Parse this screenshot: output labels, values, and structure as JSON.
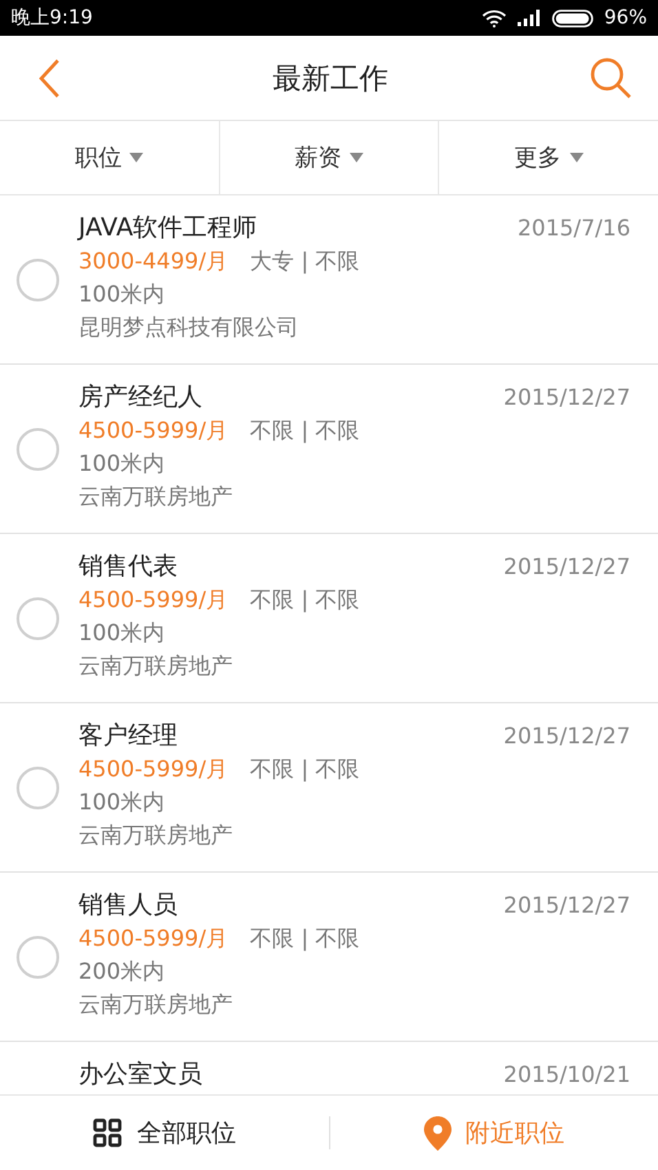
{
  "status_bar": {
    "time": "晚上9:19",
    "battery": "96%"
  },
  "header": {
    "title": "最新工作"
  },
  "filters": [
    {
      "label": "职位"
    },
    {
      "label": "薪资"
    },
    {
      "label": "更多"
    }
  ],
  "jobs": [
    {
      "title": "JAVA软件工程师",
      "date": "2015/7/16",
      "salary": "3000-4499/月",
      "requirements": "大专 | 不限",
      "distance": "100米内",
      "company": "昆明梦点科技有限公司",
      "checked": false
    },
    {
      "title": "房产经纪人",
      "date": "2015/12/27",
      "salary": "4500-5999/月",
      "requirements": "不限 | 不限",
      "distance": "100米内",
      "company": "云南万联房地产",
      "checked": false
    },
    {
      "title": "销售代表",
      "date": "2015/12/27",
      "salary": "4500-5999/月",
      "requirements": "不限 | 不限",
      "distance": "100米内",
      "company": "云南万联房地产",
      "checked": false
    },
    {
      "title": "客户经理",
      "date": "2015/12/27",
      "salary": "4500-5999/月",
      "requirements": "不限 | 不限",
      "distance": "100米内",
      "company": "云南万联房地产",
      "checked": false
    },
    {
      "title": "销售人员",
      "date": "2015/12/27",
      "salary": "4500-5999/月",
      "requirements": "不限 | 不限",
      "distance": "200米内",
      "company": "云南万联房地产",
      "checked": false
    },
    {
      "title": "办公室文员",
      "date": "2015/10/21"
    }
  ],
  "bottom_tabs": [
    {
      "kind": "grid",
      "label": "全部职位",
      "selected": false
    },
    {
      "kind": "pin",
      "label": "附近职位",
      "selected": true
    }
  ]
}
